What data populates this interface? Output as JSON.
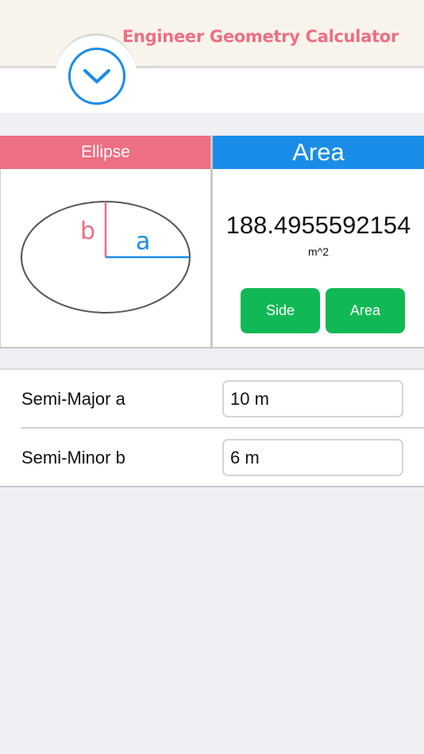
{
  "header": {
    "title": "Engineer Geometry Calculator",
    "toggle_icon": "chevron-down-icon",
    "accent_color": "#ec6f84",
    "toggle_color": "#1a8de8"
  },
  "shape": {
    "name": "Ellipse",
    "diagram_labels": {
      "major": "a",
      "minor": "b"
    },
    "color": "#ec6f84"
  },
  "result": {
    "title": "Area",
    "value": "188.4955592154",
    "unit": "m^2",
    "color": "#1a8de8"
  },
  "buttons": {
    "side_label": "Side",
    "area_label": "Area",
    "color": "#10b955"
  },
  "inputs": {
    "semi_major": {
      "label": "Semi-Major a",
      "value": "10 m"
    },
    "semi_minor": {
      "label": "Semi-Minor b",
      "value": "6 m"
    }
  }
}
